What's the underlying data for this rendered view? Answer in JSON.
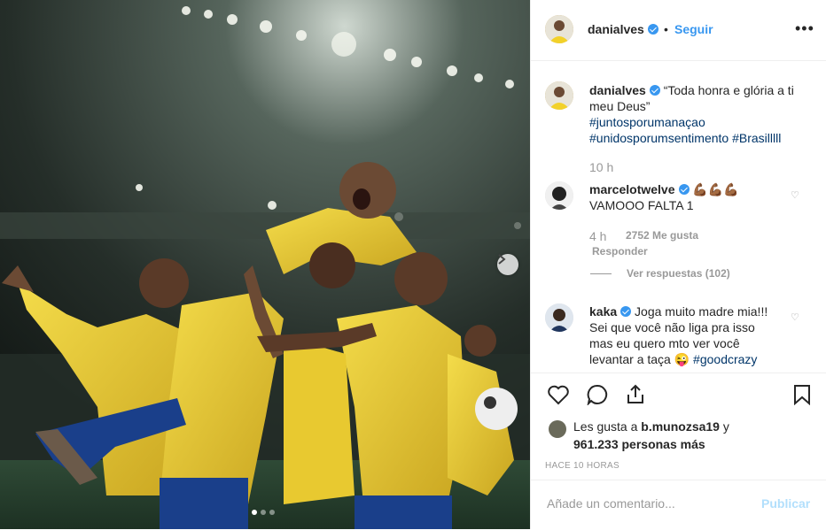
{
  "post": {
    "author": "danialves",
    "follow_label": "Seguir",
    "separator": "•",
    "more": "•••"
  },
  "caption": {
    "user": "danialves",
    "text_line1": "“Toda honra e glória a ti",
    "text_line2": "meu Deus”",
    "hashtag1": "#juntosporumanaçao",
    "hashtag2": "#unidosporumsentimento",
    "hashtag3": "#Brasilllll",
    "time": "10 h"
  },
  "comments": [
    {
      "user": "marcelotwelve",
      "emoji": "💪🏾💪🏾💪🏾",
      "text": "VAMOOO FALTA 1",
      "time": "4 h",
      "likes": "2752 Me gusta",
      "reply": "Responder",
      "view_replies": "Ver respuestas (102)"
    },
    {
      "user": "kaka",
      "line1": "Joga muito madre mia!!!",
      "line2": "Sei que você não liga pra isso",
      "line3": "mas eu quero mto ver você",
      "line4": "levantar a taça 😜",
      "hashtag": "#goodcrazy"
    }
  ],
  "likes": {
    "prefix": "Les gusta a",
    "user": "b.munozsa19",
    "conj": "y",
    "count": "961.233 personas más"
  },
  "timestamp": "HACE 10 HORAS",
  "add_comment": {
    "placeholder": "Añade un comentario...",
    "publish": "Publicar"
  },
  "carousel": {
    "current": 1,
    "total": 3
  },
  "colors": {
    "accent": "#3897f0",
    "brazil_yellow": "#f2d12a",
    "brazil_green": "#1b8a3a"
  }
}
